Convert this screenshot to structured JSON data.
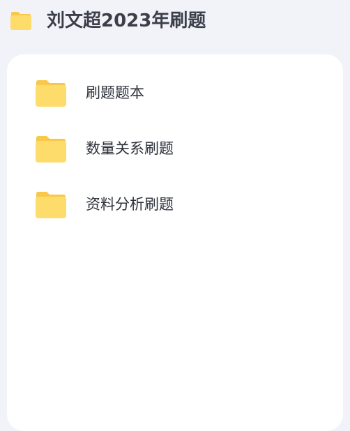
{
  "header": {
    "icon": "folder-icon",
    "title": "刘文超2023年刷题"
  },
  "folders": [
    {
      "label": "刷题题本",
      "icon": "folder-icon"
    },
    {
      "label": "数量关系刷题",
      "icon": "folder-icon"
    },
    {
      "label": "资料分析刷题",
      "icon": "folder-icon"
    }
  ],
  "colors": {
    "background": "#f2f3f8",
    "card": "#ffffff",
    "folder_front": "#fddc6b",
    "folder_back": "#f9c74a",
    "title_text": "#3a3f4a"
  }
}
